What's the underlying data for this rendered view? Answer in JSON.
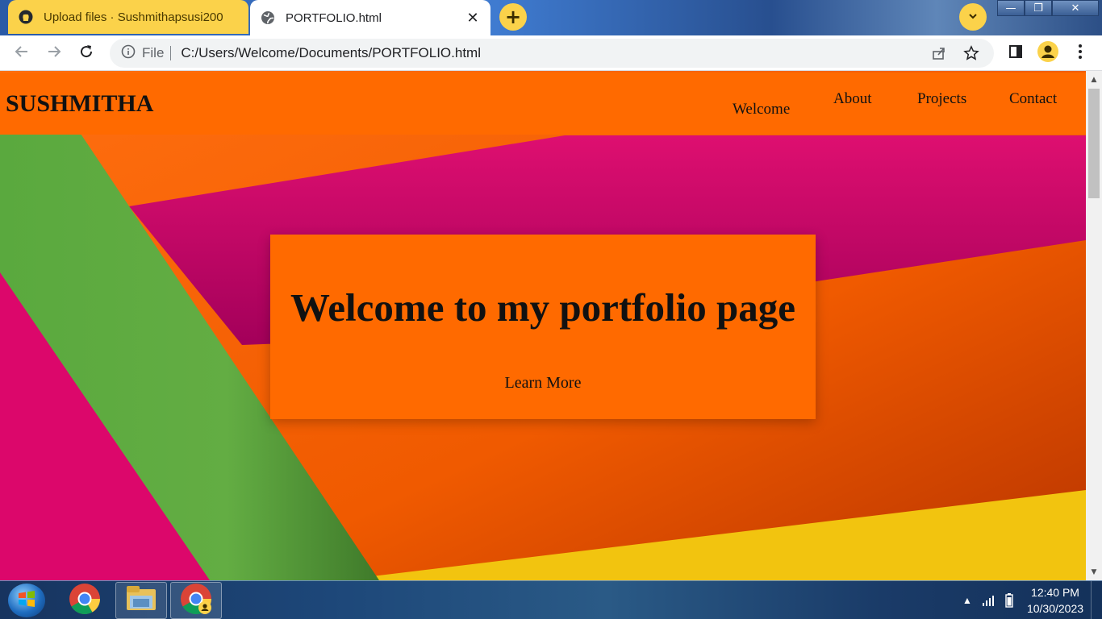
{
  "browser": {
    "tabs": [
      {
        "title": "Upload files · Sushmithapsusi200",
        "icon": "github-icon",
        "active": false
      },
      {
        "title": "PORTFOLIO.html",
        "icon": "globe-icon",
        "active": true,
        "close": "✕"
      }
    ],
    "new_tab": "+",
    "window_controls": {
      "minimize": "—",
      "maximize": "❐",
      "close": "✕"
    },
    "toolbar": {
      "site_info_label": "File",
      "url": "C:/Users/Welcome/Documents/PORTFOLIO.html"
    }
  },
  "page": {
    "brand": "SUSHMITHA",
    "nav": [
      "Welcome",
      "About",
      "Projects",
      "Contact"
    ],
    "hero": {
      "heading": "Welcome to my portfolio page",
      "button": "Learn More"
    }
  },
  "taskbar": {
    "time": "12:40 PM",
    "date": "10/30/2023"
  },
  "colors": {
    "accent_orange": "#ff6a00",
    "tab_yellow": "#fbd24a"
  }
}
